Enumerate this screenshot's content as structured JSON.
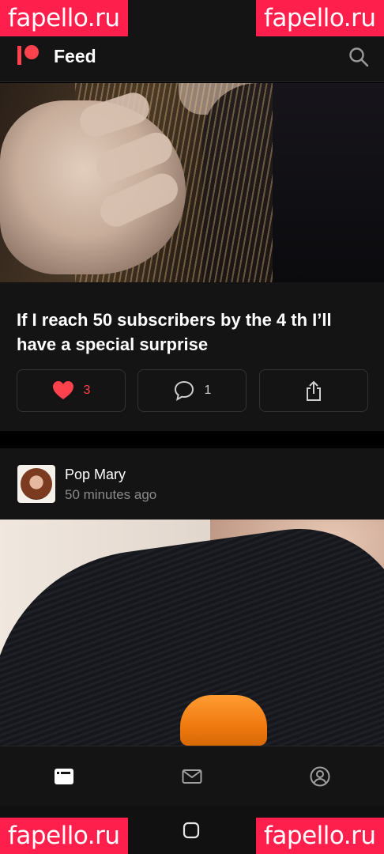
{
  "watermark": {
    "text": "fapello.ru"
  },
  "appbar": {
    "title": "Feed"
  },
  "posts": [
    {
      "title": "If I reach 50 subscribers by the 4 th I’ll have a special surprise",
      "likes": "3",
      "comments": "1"
    },
    {
      "author": "Pop Mary",
      "time": "50 minutes ago"
    }
  ],
  "colors": {
    "accent": "#ff424d",
    "background": "#141414",
    "watermark": "#ff1f4d"
  },
  "icons": [
    "patreon-logo-icon",
    "search-icon",
    "heart-icon",
    "comment-icon",
    "share-icon",
    "feed-icon",
    "mail-icon",
    "profile-icon"
  ]
}
